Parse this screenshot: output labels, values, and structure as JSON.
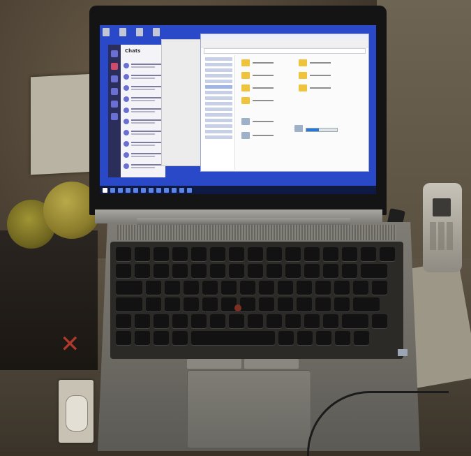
{
  "photo": {
    "subject": "laptop",
    "screen": {
      "app": "Teams",
      "chat_title": "Chats",
      "taskbar_clock": ""
    },
    "objects": [
      "tennis-ball",
      "cordless-phone",
      "papers",
      "keyboard",
      "touchpad",
      "card"
    ]
  },
  "labels": {
    "laptop_brand": "",
    "ball_text": "",
    "card_title": "",
    "phone_label": ""
  },
  "colors": {
    "screen_blue": "#2a49c8",
    "teams_rail": "#2b2d5a",
    "taskbar": "#0e1a44"
  }
}
